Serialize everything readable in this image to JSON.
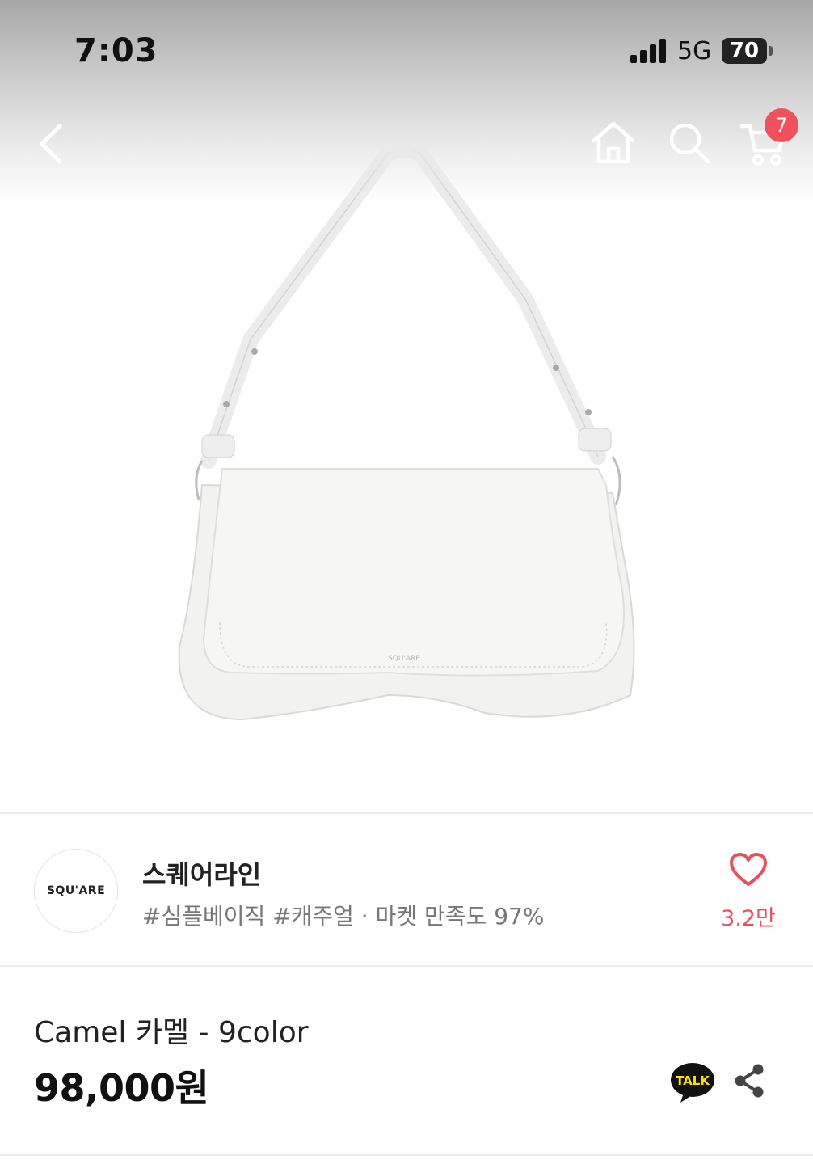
{
  "status_bar": {
    "time": "7:03",
    "network": "5G",
    "battery": "70"
  },
  "nav": {
    "cart_count": "7"
  },
  "store": {
    "logo_text": "SQU'ARE",
    "name": "스퀘어라인",
    "tags": "#심플베이직 #캐주얼 · 마켓 만족도 97%",
    "likes": "3.2만"
  },
  "product": {
    "name": "Camel  카멜 - 9color",
    "price": "98,000원",
    "talk_label": "TALK"
  },
  "colors": {
    "accent": "#f0515b",
    "like_red": "#e8505b",
    "kakao_yellow": "#fee500"
  },
  "icons": [
    "back-icon",
    "home-icon",
    "search-icon",
    "cart-icon",
    "heart-icon",
    "kakao-talk-icon",
    "share-icon"
  ]
}
